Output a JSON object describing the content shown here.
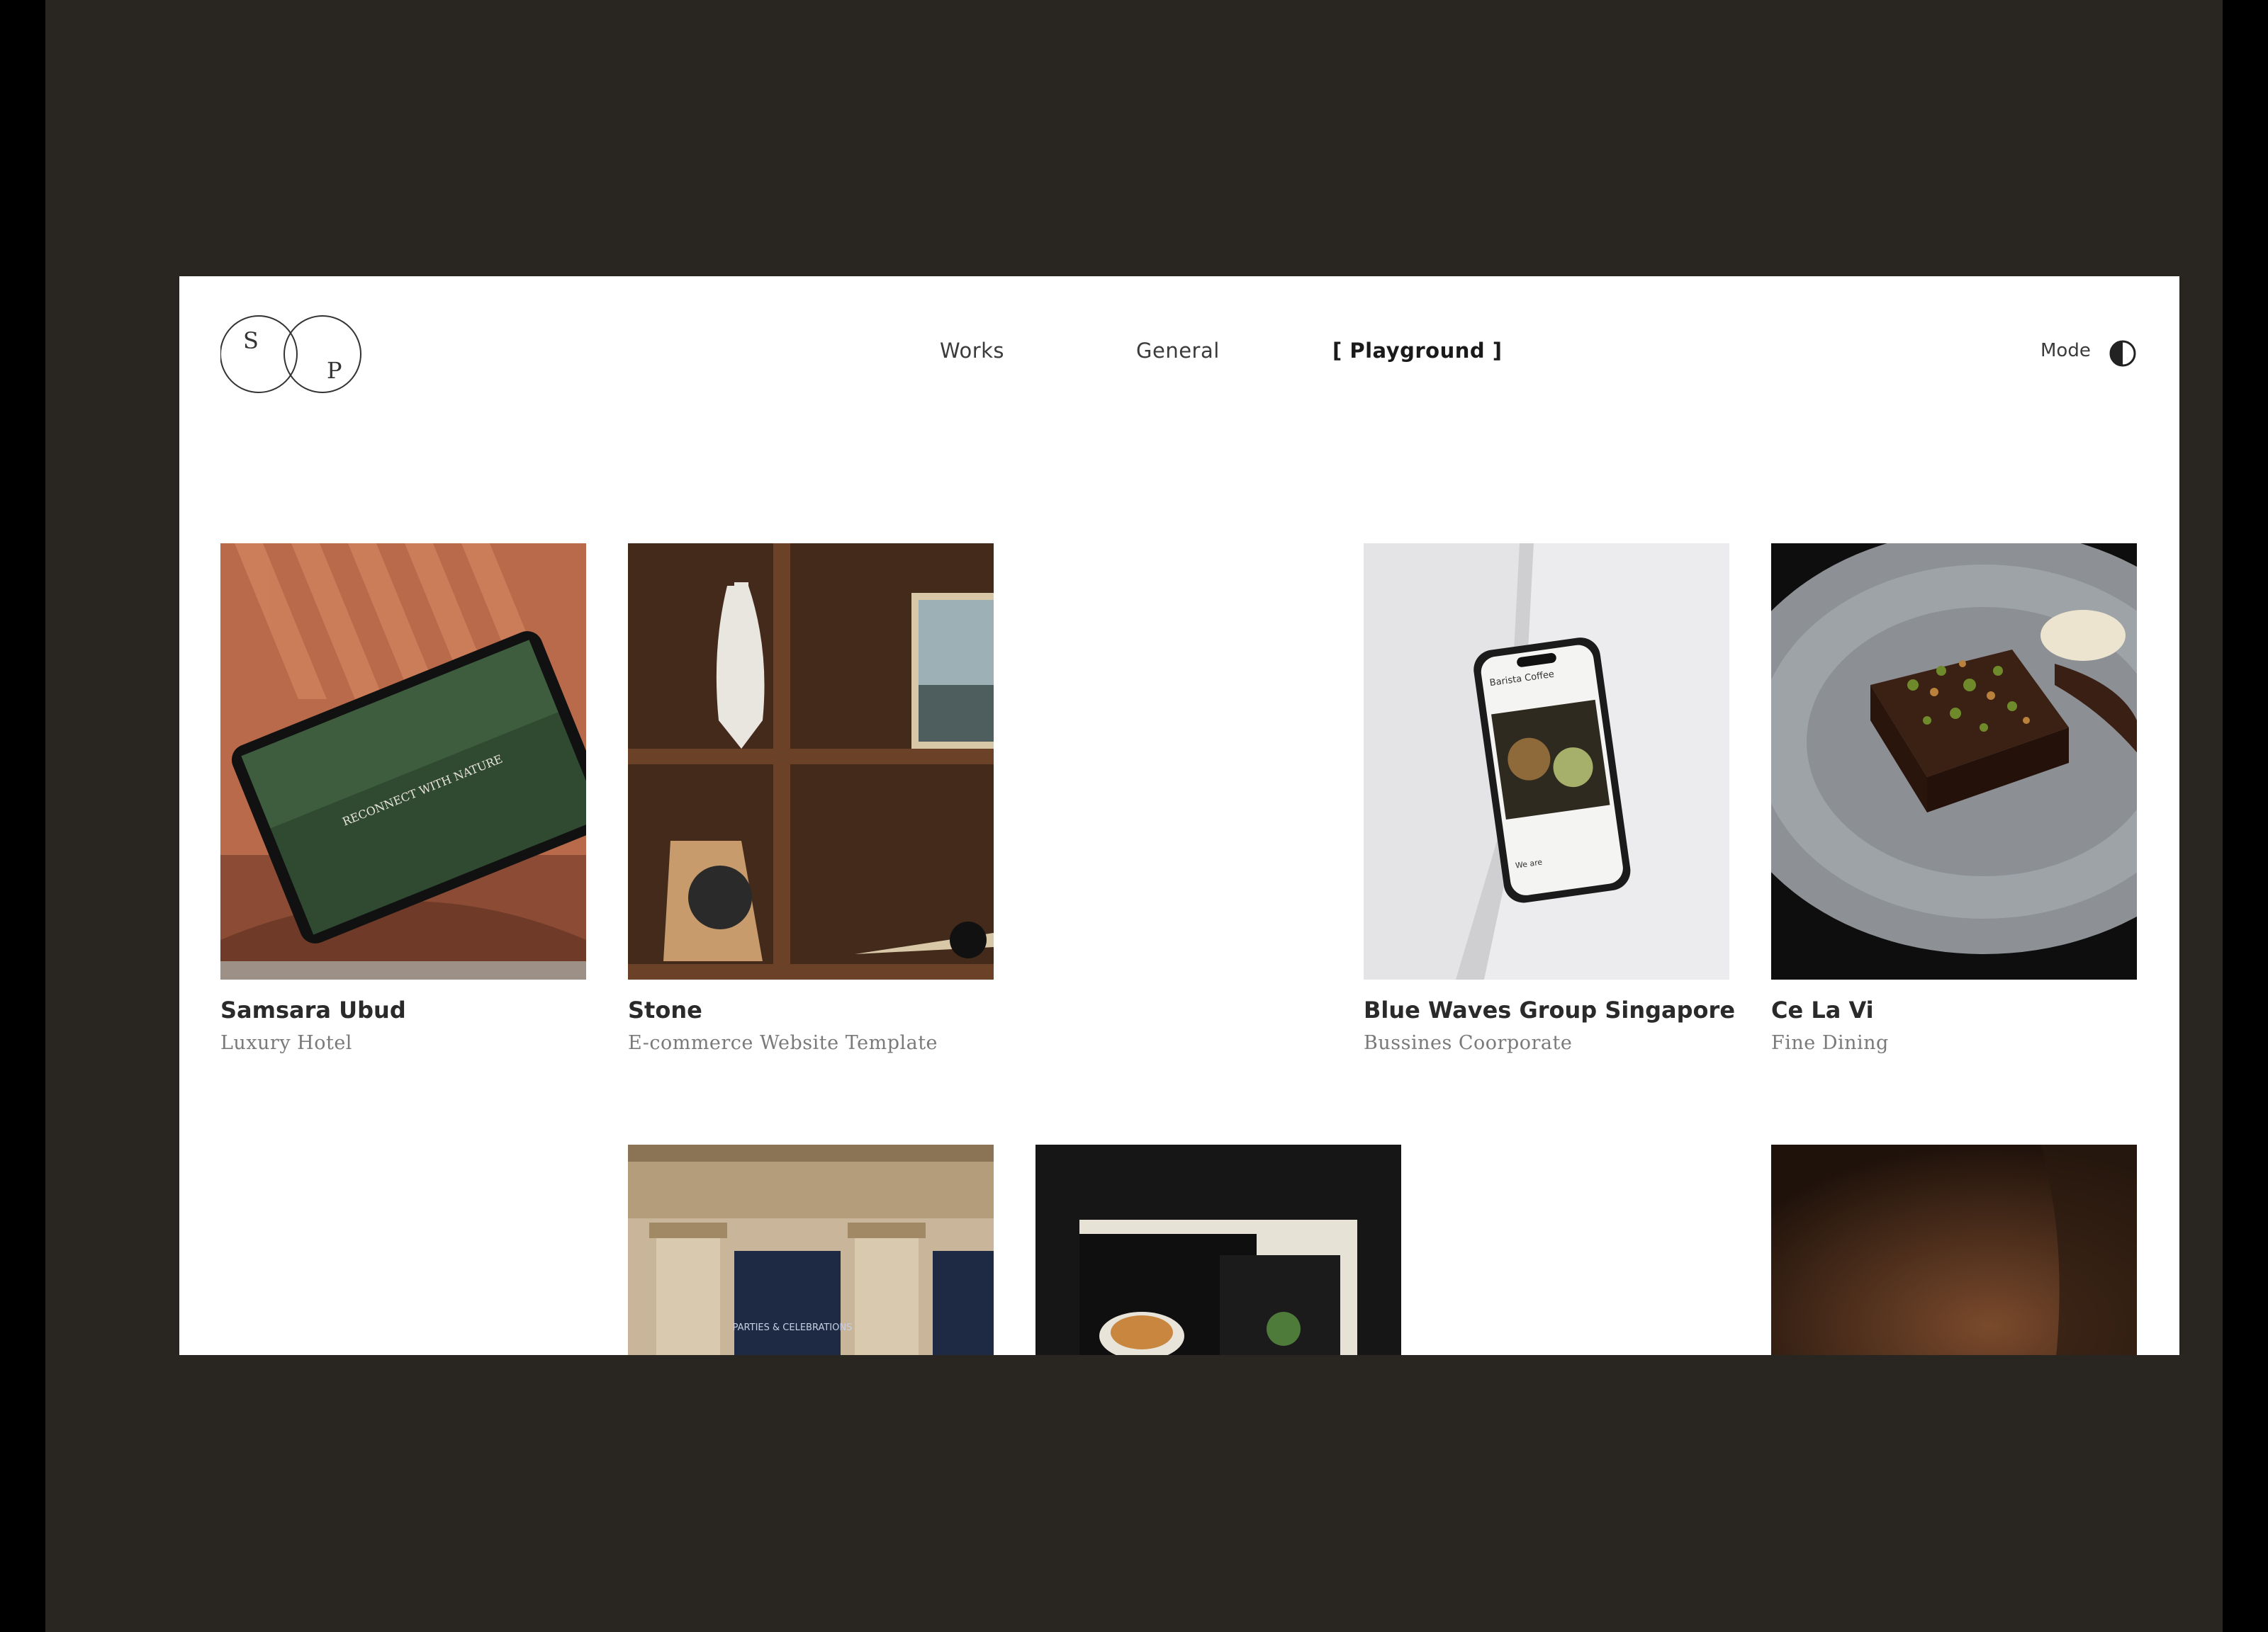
{
  "header": {
    "logo_letters": [
      "S",
      "P"
    ],
    "nav": [
      "Works",
      "General",
      "[ Playground ]"
    ],
    "mode_label": "Mode",
    "mode_icon": "half-circle-contrast-icon"
  },
  "projects": [
    {
      "title": "Samsara Ubud",
      "subtitle": "Luxury Hotel"
    },
    {
      "title": "Stone",
      "subtitle": "E-commerce Website Template"
    },
    {
      "title": "Blue Waves Group Singapore",
      "subtitle": "Bussines Coorporate"
    },
    {
      "title": "Ce La Vi",
      "subtitle": "Fine Dining"
    }
  ],
  "row2": {
    "signboard_text": "PARTIES & CELEBRATIONS"
  },
  "screen_texts": {
    "tablet_headline": "RECONNECT WITH NATURE",
    "phone_heading": "Barista Coffee",
    "phone_body": "We are"
  },
  "colors": {
    "frame": "#292520",
    "page": "#ffffff",
    "text_primary": "#2a2a2a",
    "text_secondary": "#7a7a7a"
  }
}
